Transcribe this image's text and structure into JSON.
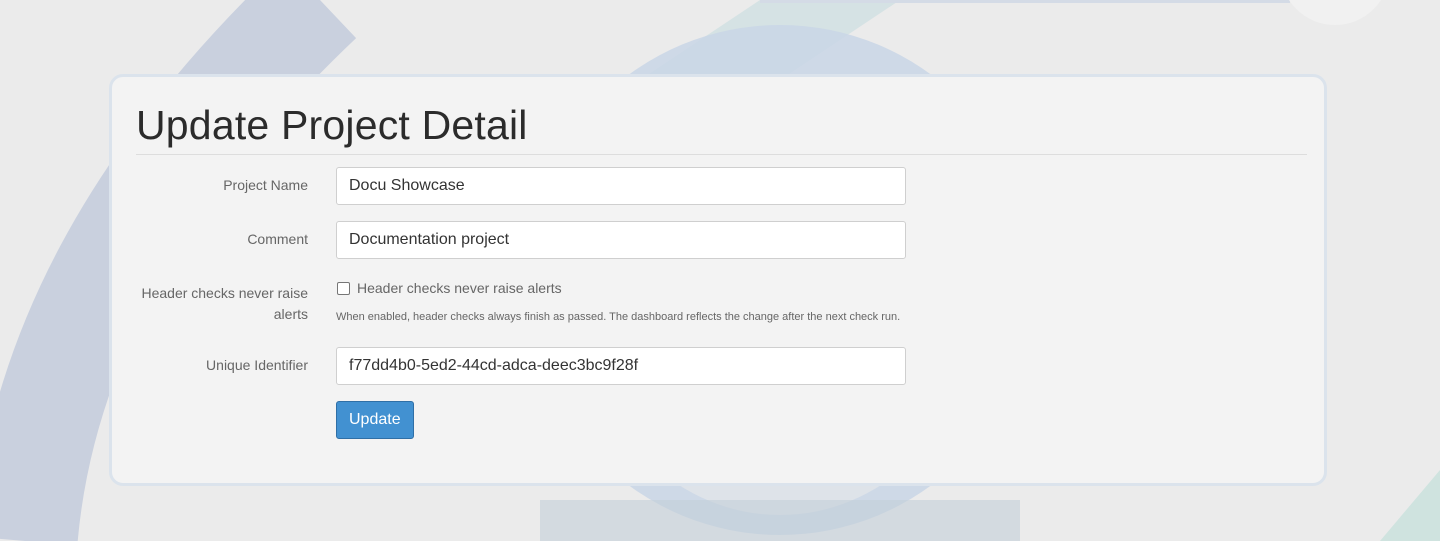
{
  "page": {
    "title": "Update Project Detail"
  },
  "form": {
    "project_name": {
      "label": "Project Name",
      "value": "Docu Showcase"
    },
    "comment": {
      "label": "Comment",
      "value": "Documentation project"
    },
    "header_checks": {
      "label_line1": "Header checks never raise",
      "label_line2": "alerts",
      "checkbox_label": "Header checks never raise alerts",
      "checked": false,
      "help_text": "When enabled, header checks always finish as passed. The dashboard reflects the change after the next check run."
    },
    "unique_identifier": {
      "label": "Unique Identifier",
      "value": "f77dd4b0-5ed2-44cd-adca-deec3bc9f28f"
    },
    "submit_label": "Update"
  },
  "colors": {
    "background": "#ebebeb",
    "card": "#f3f3f3",
    "primary_button": "#4291d1"
  }
}
